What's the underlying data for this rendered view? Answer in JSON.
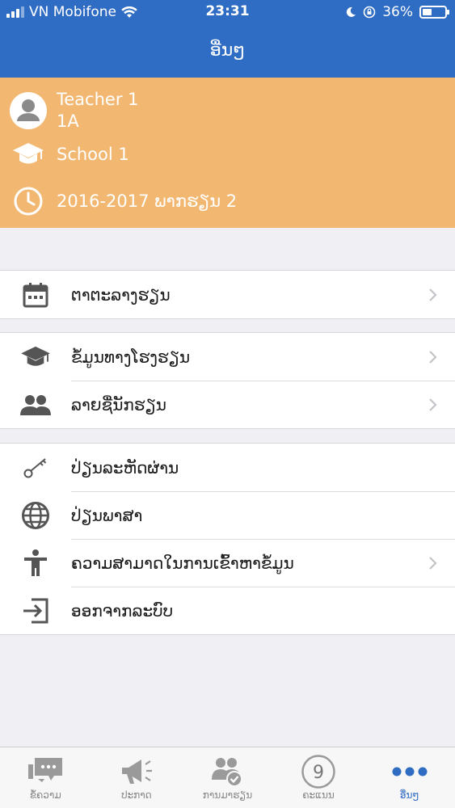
{
  "status_bar": {
    "carrier": "VN Mobifone",
    "time": "23:31",
    "battery": "36%",
    "battery_level": 0.36
  },
  "header": {
    "title": "ອື່ນໆ"
  },
  "profile": {
    "name": "Teacher 1",
    "class": "1A",
    "school": "School 1",
    "term": "2016-2017 ພາກຮຽນ 2"
  },
  "sections": {
    "schedule": {
      "label": "ຕາຕະລາງຮຽນ"
    },
    "school_info": {
      "label": "ຂໍ້ມູນທາງໂຮງຮຽນ"
    },
    "student_list": {
      "label": "ລາຍຊື່ນັກຮຽນ"
    },
    "change_password": {
      "label": "ປ່ຽນລະຫັດຜ່ານ"
    },
    "change_language": {
      "label": "ປ່ຽນພາສາ"
    },
    "accessibility": {
      "label": "ຄວາມສາມາດໃນການເຂົ້າຫາຂໍ້ມູນ"
    },
    "logout": {
      "label": "ອອກຈາກລະບົບ"
    }
  },
  "tabs": [
    {
      "label": "ຂໍ້ຄວາມ",
      "icon": "chat-icon"
    },
    {
      "label": "ປະກາດ",
      "icon": "megaphone-icon"
    },
    {
      "label": "ການມາຮຽນ",
      "icon": "attendance-icon"
    },
    {
      "label": "ຄະແນນ",
      "icon": "score-icon",
      "badge": "9"
    },
    {
      "label": "ອື່ນໆ",
      "icon": "more-dots-icon",
      "active": true
    }
  ],
  "colors": {
    "header": "#2f6cc3",
    "profile": "#f2b872",
    "active_tab": "#2f6cc3"
  }
}
